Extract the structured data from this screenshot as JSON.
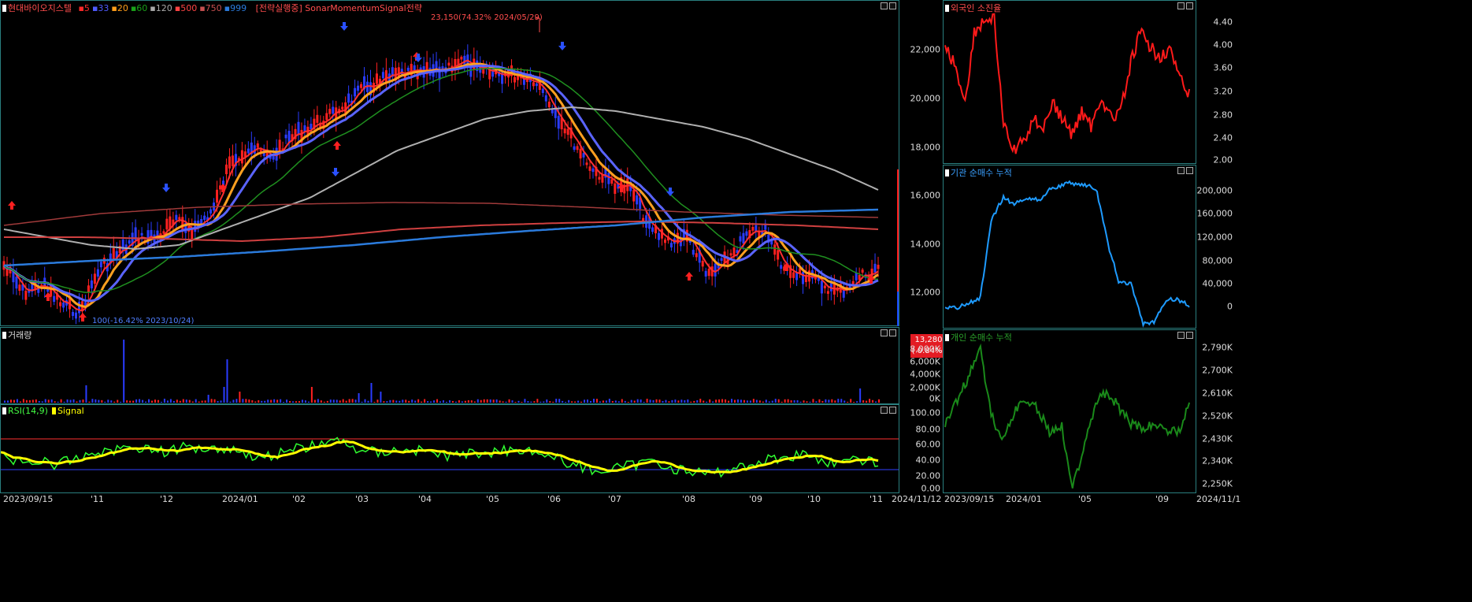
{
  "main": {
    "title_prefix": "현대바이오지스텔",
    "ma_labels": [
      "5",
      "33",
      "20",
      "60",
      "120",
      "500",
      "750",
      "999"
    ],
    "ma_colors": [
      "#ff2a2a",
      "#4f5bff",
      "#ff9e1a",
      "#1aa11a",
      "#aaaaaa",
      "#ff4444",
      "#c85050",
      "#2b7bdc"
    ],
    "strategy": "[전략실행중] SonarMomentumSignal전략",
    "high_label": "23,150(74.32% 2024/05/29)",
    "low_label": "100(-16.42% 2023/10/24)",
    "y_ticks": [
      "22,000",
      "20,000",
      "18,000",
      "16,000",
      "14,000",
      "12,000"
    ],
    "current_price": "13,280",
    "current_change": "( 0.84%)"
  },
  "volume": {
    "title": "거래량",
    "y_ticks": [
      "8,000K",
      "6,000K",
      "4,000K",
      "2,000K",
      "0K"
    ]
  },
  "rsi": {
    "title": "RSI(14,9)",
    "signal": "Signal",
    "y_ticks": [
      "100.00",
      "80.00",
      "60.00",
      "40.00",
      "20.00",
      "0.00"
    ]
  },
  "x_axis": {
    "labels": [
      "2023/09/15",
      "'11",
      "'12",
      "2024/01",
      "'02",
      "'03",
      "'04",
      "'05",
      "'06",
      "'07",
      "'08",
      "'09",
      "'10",
      "'11",
      "2024/11/12"
    ]
  },
  "foreign": {
    "title": "외국인 소진율",
    "y_ticks": [
      "4.40",
      "4.00",
      "3.60",
      "3.20",
      "2.80",
      "2.40",
      "2.00"
    ]
  },
  "institution": {
    "title": "기관 순매수 누적",
    "y_ticks": [
      "200,000",
      "160,000",
      "120,000",
      "80,000",
      "40,000",
      "0"
    ]
  },
  "individual": {
    "title": "개인 순매수 누적",
    "y_ticks": [
      "2,790K",
      "2,700K",
      "2,610K",
      "2,520K",
      "2,430K",
      "2,340K",
      "2,250K"
    ]
  },
  "right_x_axis": {
    "labels": [
      "2023/09/15",
      "2024/01",
      "'05",
      "'09",
      "2024/11/1"
    ]
  }
}
